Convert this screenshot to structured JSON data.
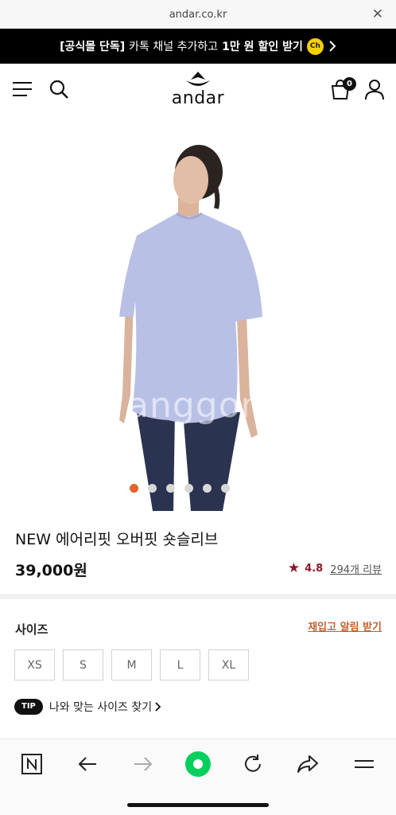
{
  "browser": {
    "url": "andar.co.kr"
  },
  "promo": {
    "bold_prefix": "[공식몰 단독]",
    "text": "카톡 채널 추가하고",
    "bold_mid": "1만 원",
    "suffix": "할인 받기",
    "channel_badge": "Ch"
  },
  "header": {
    "logo": "andar",
    "cart_count": "0"
  },
  "hero": {
    "watermark": "anggon",
    "slide_count": 6,
    "active_slide": 1
  },
  "product": {
    "name": "NEW 에어리핏 오버핏 숏슬리브",
    "price": "39,000원",
    "rating": "4.8",
    "review_link": "294개 리뷰",
    "color_hex": "#b9c0e6"
  },
  "size_section": {
    "label": "사이즈",
    "restock_link": "재입고 알림 받기",
    "options": [
      "XS",
      "S",
      "M",
      "L",
      "XL"
    ],
    "tip_badge": "TIP",
    "tip_text": "나와 맞는 사이즈 찾기"
  },
  "colors": {
    "accent_orange": "#e2622a",
    "rating_red": "#8b1a2a",
    "naver_green": "#03cf5d"
  }
}
